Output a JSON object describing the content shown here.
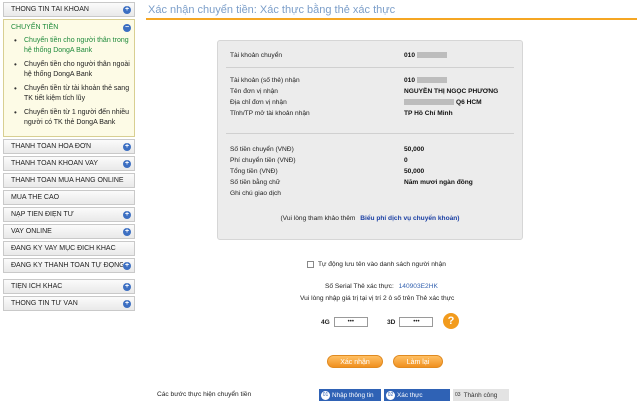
{
  "sidebar": {
    "top_item": "THÔNG TIN TÀI KHOẢN",
    "transfer_group": {
      "title": "CHUYỂN TIỀN",
      "items": [
        {
          "label": "Chuyển tiền cho người thân trong hệ thống DongA Bank"
        },
        {
          "label": "Chuyển tiền cho người thân ngoài hệ thống DongA Bank"
        },
        {
          "label": "Chuyển tiền từ tài khoản thẻ sang TK tiết kiệm tích lũy"
        },
        {
          "label": "Chuyển tiền từ 1 người đến nhiều người có TK thẻ DongA Bank"
        }
      ]
    },
    "items": [
      {
        "label": "THANH TOÁN HÓA ĐƠN",
        "icon": "+"
      },
      {
        "label": "THANH TOÁN KHOẢN VAY",
        "icon": "+"
      },
      {
        "label": "THANH TOÁN MUA HÀNG ONLINE",
        "icon": ""
      },
      {
        "label": "MUA THẺ CÀO",
        "icon": ""
      },
      {
        "label": "NẠP TIỀN ĐIỆN TỬ",
        "icon": "+"
      },
      {
        "label": "VAY ONLINE",
        "icon": "+"
      },
      {
        "label": "ĐĂNG KÝ VAY MỤC ĐÍCH KHÁC",
        "icon": ""
      },
      {
        "label": "ĐĂNG KÝ THANH TOÁN TỰ ĐỘNG",
        "icon": "+"
      }
    ],
    "bottom_items": [
      {
        "label": "TIỆN ÍCH KHÁC",
        "icon": "+"
      },
      {
        "label": "THÔNG TIN TƯ VẤN",
        "icon": "+"
      }
    ]
  },
  "header": {
    "title": "Xác nhận chuyển tiền: Xác thực bằng thẻ xác thực"
  },
  "details": {
    "source_account_label": "Tài khoản chuyển",
    "source_account_value": "010",
    "dest_account_label": "Tài khoản (số thẻ) nhận",
    "dest_account_value": "010",
    "recipient_name_label": "Tên đơn vị nhận",
    "recipient_name_value": "NGUYỄN THỊ NGỌC PHƯƠNG",
    "address_label": "Địa chỉ đơn vị nhận",
    "address_value": "Q6 HCM",
    "province_label": "Tỉnh/TP mở tài khoản nhận",
    "province_value": "TP Hồ Chí Minh",
    "amount_label": "Số tiền chuyển (VNĐ)",
    "amount_value": "50,000",
    "fee_label": "Phí chuyển tiền (VNĐ)",
    "fee_value": "0",
    "total_label": "Tổng tiền (VNĐ)",
    "total_value": "50,000",
    "words_label": "Số tiền bằng chữ",
    "words_value": "Năm mươi ngàn đồng",
    "note_label": "Ghi chú giao dịch",
    "note_value": "",
    "fee_ref_text": "(Vui lòng tham khảo thêm",
    "fee_ref_link": "Biểu phí dịch vụ chuyển khoản)"
  },
  "verify": {
    "save_label": "Tự động lưu tên vào danh sách người nhận",
    "serial_label": "Số Serial Thẻ xác thực:",
    "serial_value": "140903E2HK",
    "hint": "Vui lòng nhập giá trị tại vị trí 2 ô số trên Thẻ xác thực",
    "field1_label": "4G",
    "field1_value": "•••",
    "field2_label": "3D",
    "field2_value": "•••",
    "help_icon": "?"
  },
  "buttons": {
    "confirm": "Xác nhận",
    "reset": "Làm lại"
  },
  "steps": {
    "label": "Các bước thực hiện chuyển tiền",
    "items": [
      {
        "no": "01",
        "label": "Nhập thông tin"
      },
      {
        "no": "02",
        "label": "Xác thực"
      },
      {
        "no": "03",
        "label": "Thành công"
      }
    ]
  },
  "colors": {
    "accent_orange": "#f29b1d",
    "title_blue": "#7b9ec9",
    "step_blue": "#2f62b5",
    "active_green": "#1f8a3b"
  }
}
